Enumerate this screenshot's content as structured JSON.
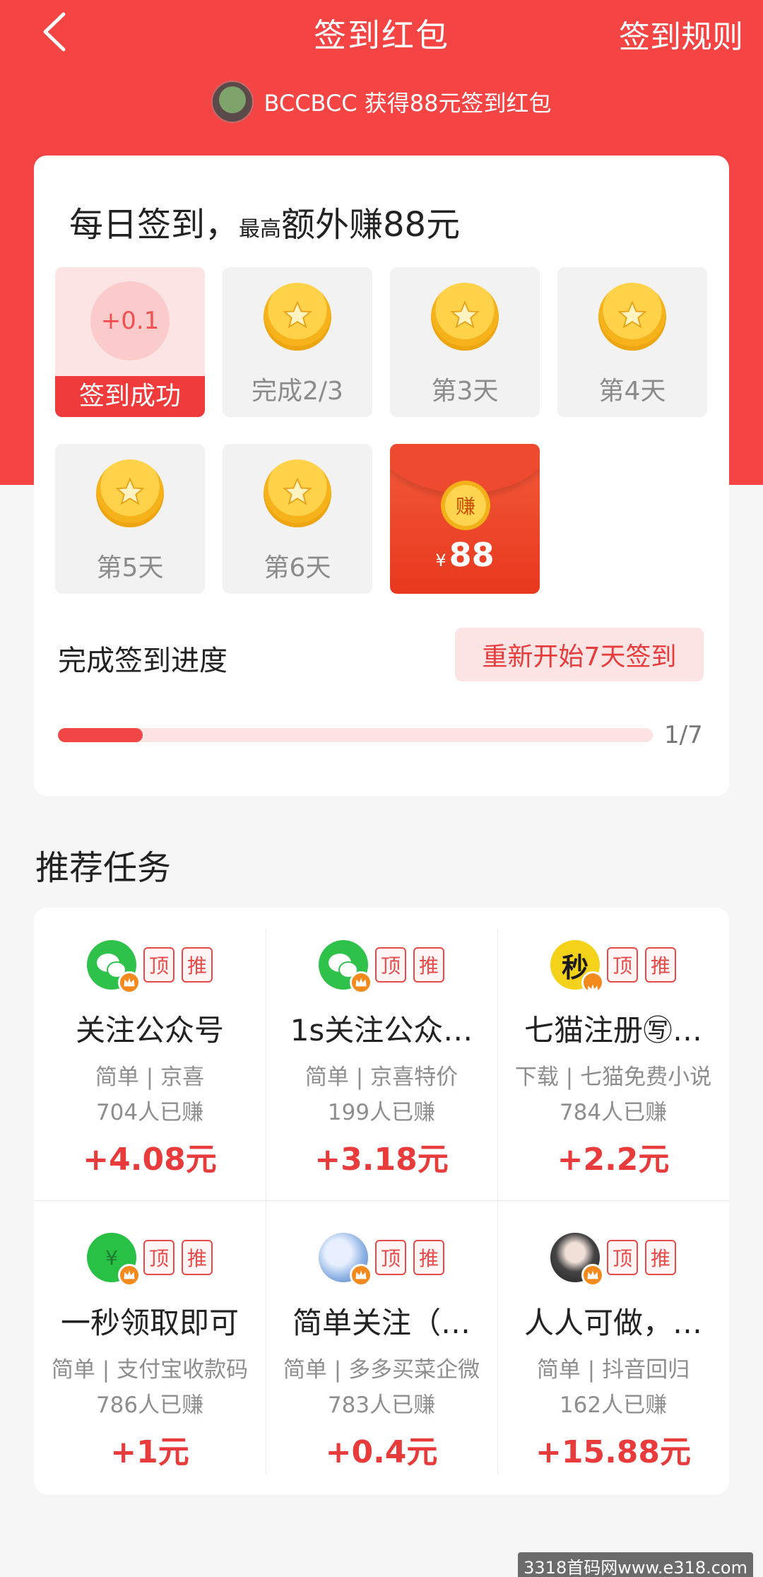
{
  "header": {
    "title": "签到红包",
    "rules_label": "签到规则",
    "back_icon": "chevron-left-icon"
  },
  "ticker": {
    "text": "BCCBCC 获得88元签到红包"
  },
  "signin": {
    "title_main": "每日签到，",
    "title_small": "最高",
    "title_tail": "额外赚88元",
    "days": [
      {
        "state": "done",
        "bonus": "+0.1",
        "label": "签到成功"
      },
      {
        "state": "coin",
        "label": "完成2/3"
      },
      {
        "state": "coin",
        "label": "第3天"
      },
      {
        "state": "coin",
        "label": "第4天"
      },
      {
        "state": "coin",
        "label": "第5天"
      },
      {
        "state": "coin",
        "label": "第6天"
      }
    ],
    "final": {
      "coin_text": "赚",
      "currency": "¥",
      "amount": "88"
    },
    "progress_title": "完成签到进度",
    "restart_label": "重新开始7天签到",
    "progress_text": "1/7",
    "progress_fraction": 0.1428
  },
  "tasks": {
    "section_title": "推荐任务",
    "tag_top": "顶",
    "tag_push": "推",
    "items": [
      {
        "icon": "wechat-icon",
        "name": "关注公众号",
        "desc": "简单 | 京喜",
        "count": "704人已赚",
        "reward": "+4.08元"
      },
      {
        "icon": "wechat-icon",
        "name": "1s关注公众…",
        "desc": "简单 | 京喜特价",
        "count": "199人已赚",
        "reward": "+3.18元"
      },
      {
        "icon": "qimao-icon",
        "name": "七猫注册㊢…",
        "desc": "下载 | 七猫免费小说",
        "count": "784人已赚",
        "reward": "+2.2元"
      },
      {
        "icon": "alipay-icon",
        "name": "一秒领取即可",
        "desc": "简单 | 支付宝收款码",
        "count": "786人已赚",
        "reward": "+1元"
      },
      {
        "icon": "sky-avatar-icon",
        "name": "简单关注（…",
        "desc": "简单 | 多多买菜企微",
        "count": "783人已赚",
        "reward": "+0.4元"
      },
      {
        "icon": "girl-avatar-icon",
        "name": "人人可做，…",
        "desc": "简单 | 抖音回归",
        "count": "162人已赚",
        "reward": "+15.88元"
      }
    ]
  },
  "watermark": "3318首码网www.e318.com",
  "colors": {
    "brand_red": "#f44444",
    "reward_red": "#e83c3c",
    "coin_gold": "#f6b21b"
  }
}
